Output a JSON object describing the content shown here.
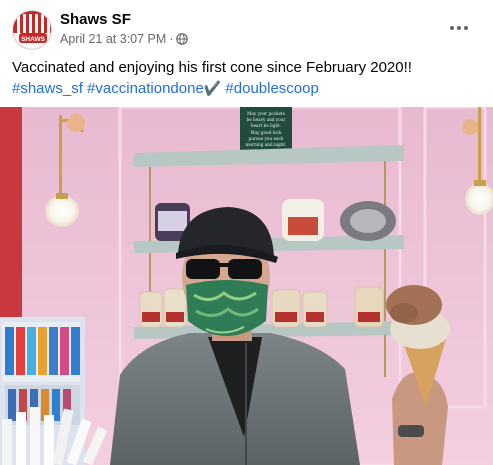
{
  "post": {
    "author": "Shaws SF",
    "timestamp": "April 21 at 3:07 PM",
    "separator": "·",
    "privacy_icon": "globe-icon",
    "message": "Vaccinated and enjoying his first cone since February 2020!!",
    "hashtags": [
      "#shaws_sf",
      "#vaccinationdone",
      "#doublescoop"
    ],
    "checkmark": "✔️",
    "avatar_text": "SHAWS",
    "menu_icon": "more-options-icon"
  },
  "photo": {
    "wall_sign_lines": [
      "May your pockets",
      "be heavy and your",
      "heart be light.",
      "May good luck",
      "pursue you each",
      "morning and night."
    ],
    "subject": "person-with-ice-cream-cone"
  },
  "colors": {
    "link": "#216fdb",
    "text": "#050505",
    "meta": "#65676b",
    "wall": "#f0bfd6",
    "shelf": "#b7c8c4"
  }
}
